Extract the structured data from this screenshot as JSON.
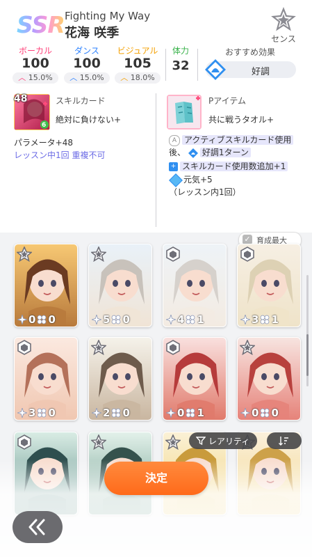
{
  "header": {
    "rarity": "SSR",
    "title": "Fighting My Way",
    "character_name": "花海 咲季",
    "sense_label": "センス"
  },
  "stats": {
    "vocal": {
      "label": "ボーカル",
      "value": "100",
      "bonus": "15.0%"
    },
    "dance": {
      "label": "ダンス",
      "value": "100",
      "bonus": "15.0%"
    },
    "visual": {
      "label": "ビジュアル",
      "value": "105",
      "bonus": "18.0%"
    },
    "stamina": {
      "label": "体力",
      "value": "32"
    },
    "recommended": {
      "label": "おすすめ効果",
      "value": "好調"
    }
  },
  "skill_card": {
    "cost": "48",
    "level": "6",
    "heading": "スキルカード",
    "name": "絶対に負けない+",
    "parameter": "パラメータ+48",
    "limit": "レッスン中1回 重複不可"
  },
  "p_item": {
    "heading": "Pアイテム",
    "name": "共に戦うタオル+",
    "effects": {
      "e1_prefix": "A",
      "e1_text": "アクティブスキルカード使用",
      "e2_a": "後、",
      "e2_b": "好調1ターン",
      "e3": "スキルカード使用数追加+1",
      "e4": "元気+5",
      "e5": "（レッスン内1回）"
    }
  },
  "grid": {
    "max_toggle_label": "育成最大",
    "cards": [
      {
        "type": "sense",
        "stars": "0",
        "clovers": "0"
      },
      {
        "type": "sense",
        "stars": "5",
        "clovers": "0"
      },
      {
        "type": "logic",
        "stars": "4",
        "clovers": "1"
      },
      {
        "type": "logic",
        "stars": "3",
        "clovers": "1"
      },
      {
        "type": "logic",
        "stars": "3",
        "clovers": "0"
      },
      {
        "type": "sense",
        "stars": "2",
        "clovers": "0"
      },
      {
        "type": "logic",
        "stars": "0",
        "clovers": "1"
      },
      {
        "type": "sense",
        "stars": "0",
        "clovers": "0"
      },
      {
        "type": "logic",
        "stars": "",
        "clovers": ""
      },
      {
        "type": "sense",
        "stars": "",
        "clovers": ""
      },
      {
        "type": "sense",
        "stars": "",
        "clovers": ""
      },
      {
        "type": "sense",
        "stars": "",
        "clovers": ""
      }
    ],
    "sort_label": "レアリティ"
  },
  "footer": {
    "confirm_label": "決定"
  },
  "colors": {
    "vocal": "#ff3f78",
    "dance": "#2d82ff",
    "visual": "#f4a000",
    "stamina": "#38b24a",
    "confirm": "#ff6a1a"
  }
}
